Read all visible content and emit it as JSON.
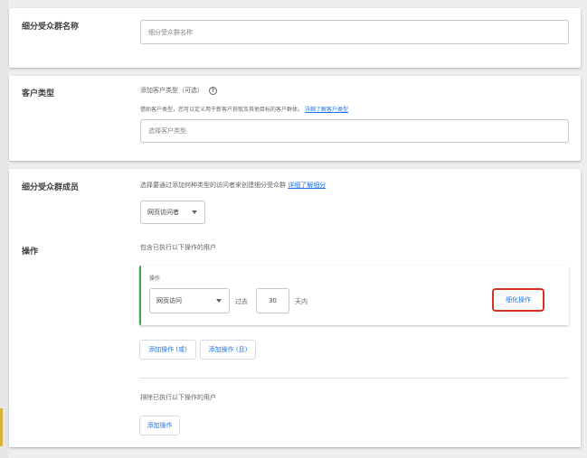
{
  "segment_name": {
    "label": "细分受众群名称",
    "placeholder": "细分受众群名称"
  },
  "customer_type": {
    "label": "客户类型",
    "add_text": "添加客户类型（可选）",
    "help_icon": "?",
    "description": "借助客户类型，您可以定义用于新客户获取及其他目标的客户群体。",
    "learn_more": "详细了解客户类型",
    "select_placeholder": "选择客户类型"
  },
  "members": {
    "label": "细分受众群成员",
    "description": "选择要通过添加何种类型的访问者来创建细分受众群",
    "learn_more": "详细了解细分",
    "visitor_select": "网页访问者"
  },
  "actions": {
    "label": "操作",
    "include_text": "包含已执行以下操作的用户",
    "box_title": "操作",
    "action_select": "网页访问",
    "past_label": "过去",
    "days_value": "30",
    "days_unit": "天内",
    "refine_button": "细化操作",
    "add_or_button": "添加操作 (或)",
    "add_and_button": "添加操作 (且)",
    "exclude_text": "排除已执行以下操作的用户",
    "add_action_button": "添加操作"
  },
  "colors": {
    "link": "#1a73e8",
    "highlight_border": "#d93025",
    "action_accent": "#34a853"
  }
}
